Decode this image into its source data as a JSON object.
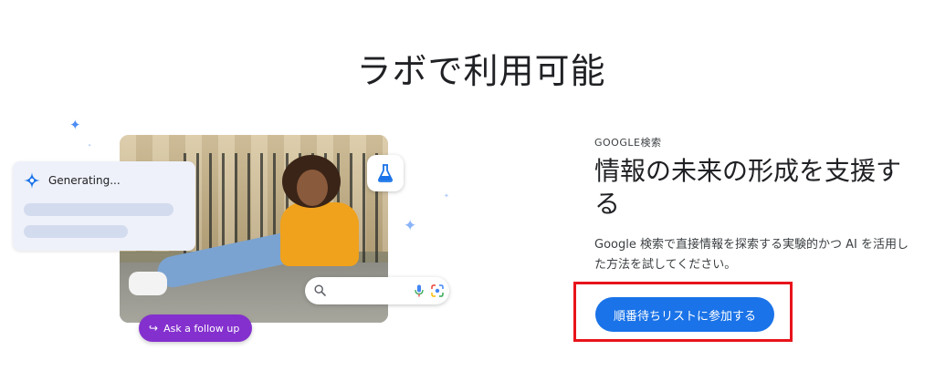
{
  "section": {
    "title": "ラボで利用可能"
  },
  "illustration": {
    "generating_label": "Generating...",
    "follow_up_label": "Ask a follow up",
    "icons": [
      "sparkle-icon",
      "flask-icon",
      "gemini-star-icon",
      "search-icon",
      "mic-icon",
      "lens-icon",
      "follow-up-arrow-icon"
    ]
  },
  "feature": {
    "eyebrow": "GOOGLE検索",
    "headline": "情報の未来の形成を支援する",
    "description": "Google 検索で直接情報を探索する実験的かつ AI を活用した方法を試してください。",
    "cta_label": "順番待ちリストに参加する"
  },
  "colors": {
    "primary_button": "#1a73e8",
    "follow_up_chip": "#8430ce",
    "highlight_border": "#e8141b",
    "text_primary": "#202124"
  }
}
